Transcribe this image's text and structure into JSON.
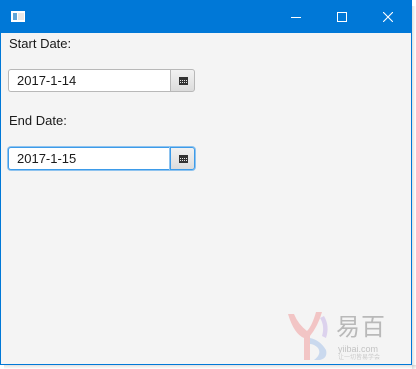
{
  "window": {
    "accent_color": "#0078d7",
    "icon": "app-window-icon",
    "controls": {
      "minimize_icon": "minimize-icon",
      "maximize_icon": "maximize-icon",
      "close_icon": "close-icon"
    }
  },
  "form": {
    "start_label": "Start Date:",
    "start_value": "2017-1-14",
    "end_label": "End Date:",
    "end_value": "2017-1-15",
    "calendar_icon": "calendar-icon"
  },
  "watermark": {
    "brand": "易百",
    "url": "yiibai.com",
    "tagline": "让一切皆易学会"
  }
}
